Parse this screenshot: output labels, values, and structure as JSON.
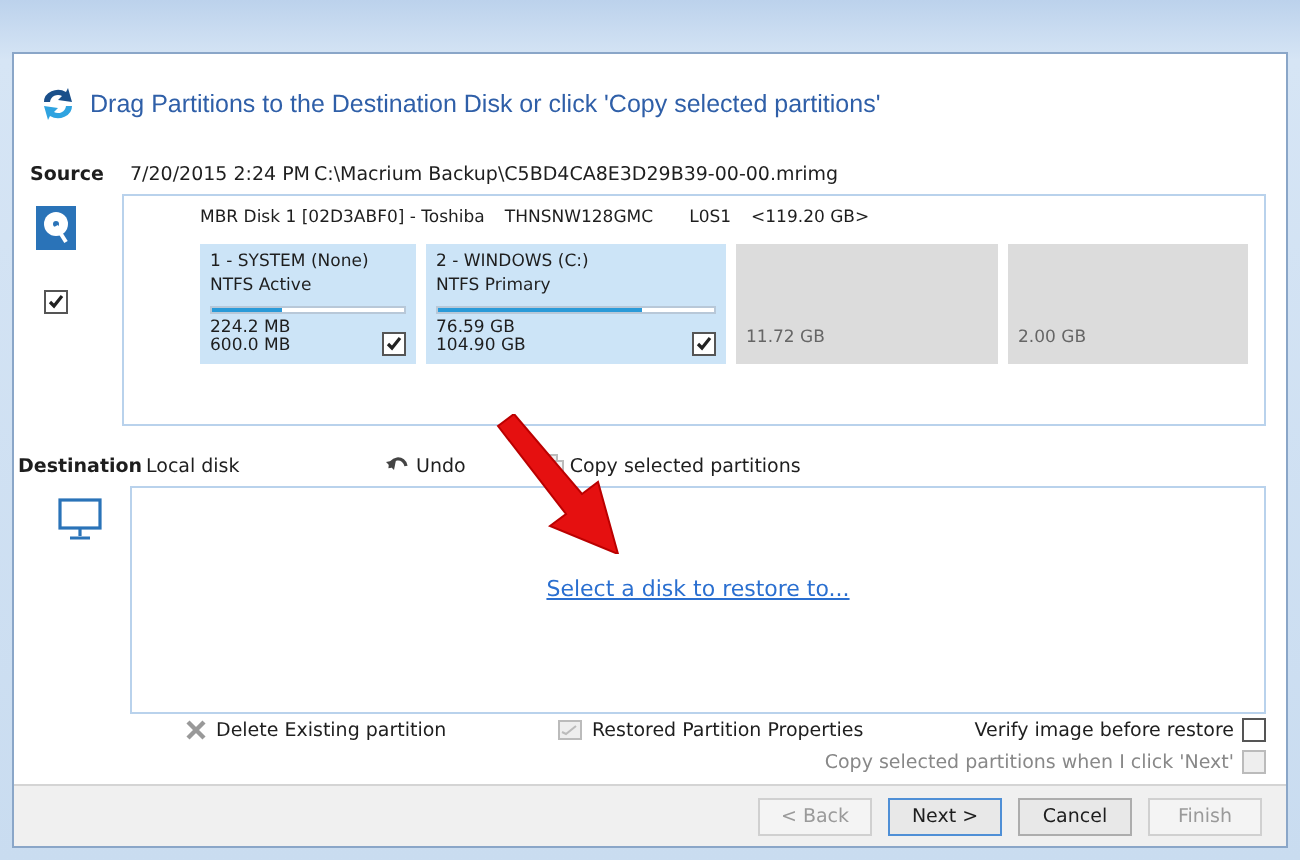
{
  "header": {
    "title": "Drag Partitions to the Destination Disk or click 'Copy selected partitions'"
  },
  "source": {
    "label": "Source",
    "date": "7/20/2015 2:24 PM",
    "path": "C:\\Macrium Backup\\C5BD4CA8E3D29B39-00-00.mrimg",
    "disk": {
      "checked": true,
      "name": "MBR Disk 1 [02D3ABF0] - Toshiba",
      "model": "THNSNW128GMC",
      "fw": "L0S1",
      "size": "<119.20 GB>",
      "partitions": [
        {
          "kind": "used",
          "title": "1 - SYSTEM (None)",
          "fs": "NTFS Active",
          "level": 0.36,
          "used": "224.2 MB",
          "total": "600.0 MB",
          "checked": true
        },
        {
          "kind": "used",
          "title": "2 - WINDOWS (C:)",
          "fs": "NTFS Primary",
          "level": 0.74,
          "used": "76.59 GB",
          "total": "104.90 GB",
          "checked": true
        },
        {
          "kind": "unallocated",
          "size": "11.72 GB"
        },
        {
          "kind": "unallocated",
          "size": "2.00 GB"
        }
      ]
    }
  },
  "destination": {
    "label": "Destination",
    "disk": "Local disk",
    "undo": "Undo",
    "copy": "Copy selected partitions",
    "link": "Select a disk to restore to..."
  },
  "actions": {
    "delete": "Delete Existing partition",
    "properties": "Restored Partition Properties"
  },
  "options": [
    {
      "label": "Verify image before restore",
      "checked": false,
      "disabled": false
    },
    {
      "label": "Copy selected partitions when I click 'Next'",
      "checked": false,
      "disabled": true
    }
  ],
  "buttons": [
    {
      "label": "< Back",
      "disabled": true
    },
    {
      "label": "Next >",
      "disabled": false,
      "default": true
    },
    {
      "label": "Cancel",
      "disabled": false
    },
    {
      "label": "Finish",
      "disabled": true
    }
  ]
}
